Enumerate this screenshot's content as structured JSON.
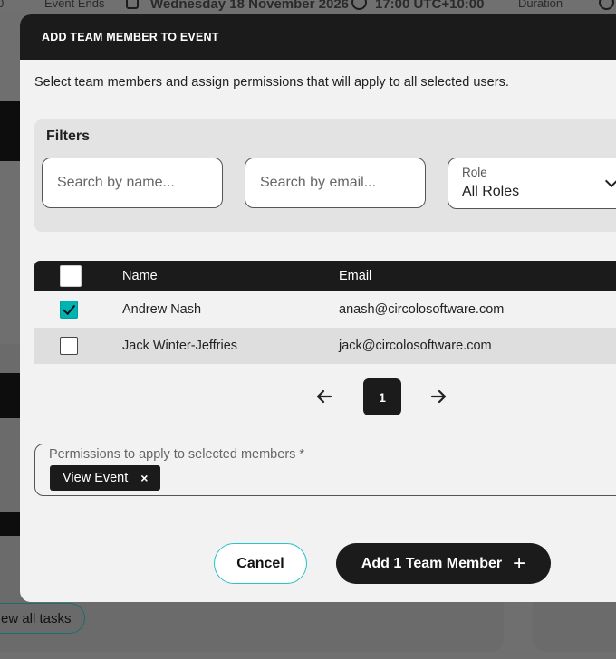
{
  "background": {
    "event_ends_label": "Event Ends",
    "event_end_date": "Wednesday 18 November 2026",
    "event_end_time": "17:00 UTC+10:00",
    "duration_label": "Duration",
    "left_fragment": "0",
    "view_all_tasks": "ew all tasks"
  },
  "modal": {
    "title": "ADD TEAM MEMBER TO EVENT",
    "description": "Select team members and assign permissions that will apply to all selected users.",
    "filters": {
      "title": "Filters",
      "name_placeholder": "Search by name...",
      "email_placeholder": "Search by email...",
      "role_label": "Role",
      "role_value": "All Roles"
    },
    "table": {
      "columns": [
        "Name",
        "Email"
      ],
      "rows": [
        {
          "name": "Andrew Nash",
          "email": "anash@circolosoftware.com",
          "selected": true
        },
        {
          "name": "Jack Winter-Jeffries",
          "email": "jack@circolosoftware.com",
          "selected": false
        }
      ]
    },
    "pagination": {
      "current_page": "1",
      "prev_icon": "arrow-left-icon",
      "next_icon": "arrow-right-icon"
    },
    "permissions": {
      "label": "Permissions to apply to selected members *",
      "chips": [
        {
          "label": "View Event",
          "remove": "×"
        }
      ]
    },
    "buttons": {
      "cancel": "Cancel",
      "add": "Add 1 Team Member",
      "add_icon": "plus-icon"
    }
  },
  "colors": {
    "accent": "#2bc4c4",
    "dark": "#1b1b1b",
    "checkbox_checked": "#00b3b3"
  }
}
